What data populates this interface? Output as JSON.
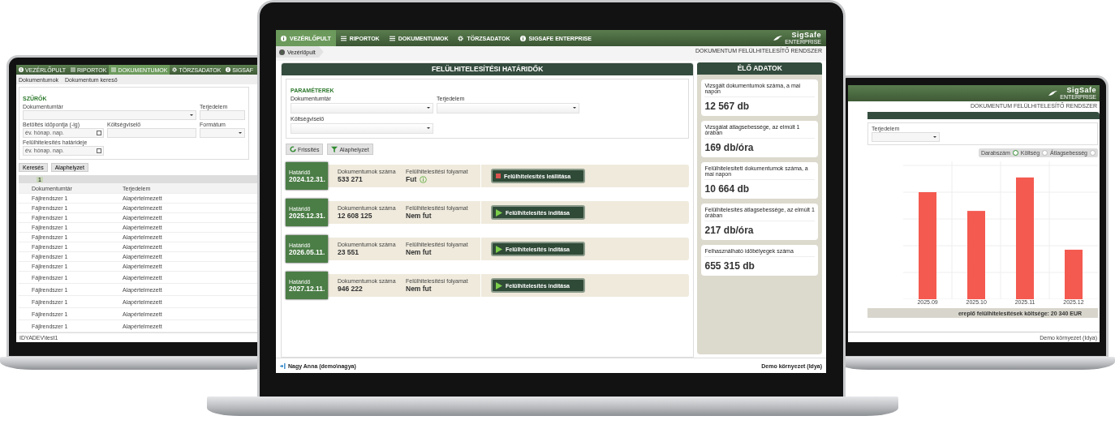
{
  "center": {
    "nav": [
      {
        "label": "VEZÉRLŐPULT",
        "selected": true
      },
      {
        "label": "RIPORTOK",
        "selected": false
      },
      {
        "label": "DOKUMENTUMOK",
        "selected": false
      },
      {
        "label": "TÖRZSADATOK",
        "selected": false
      },
      {
        "label": "SIGSAFE ENTERPRISE",
        "selected": false
      }
    ],
    "logo": {
      "name": "SigSafe",
      "sub": "ENTERPRISE"
    },
    "breadcrumb": "Vezérlőpult",
    "system_title": "DOKUMENTUM FELÜLHITELESÍTŐ RENDSZER",
    "deadlines": {
      "title": "FELÜLHITELESÍTÉSI HATÁRIDŐK",
      "legend": "PARAMÉTEREK",
      "fields": [
        {
          "label": "Dokumentumtár"
        },
        {
          "label": "Terjedelem"
        },
        {
          "label": "Költségviselő"
        }
      ],
      "buttons": [
        "Frissítés",
        "Alaphelyzet"
      ],
      "rows": [
        {
          "deadline_label": "Határidő",
          "date": "2024.12.31.",
          "count_label": "Dokumentumok száma",
          "count": "533 271",
          "process_label": "Felülhitelesítési folyamat",
          "status": "Fut",
          "running": true,
          "action": "Felülhitelesítés leállítása"
        },
        {
          "deadline_label": "Határidő",
          "date": "2025.12.31.",
          "count_label": "Dokumentumok száma",
          "count": "12 608 125",
          "process_label": "Felülhitelesítési folyamat",
          "status": "Nem fut",
          "running": false,
          "action": "Felülhitelesítés indítása"
        },
        {
          "deadline_label": "Határidő",
          "date": "2026.05.11.",
          "count_label": "Dokumentumok száma",
          "count": "23 551",
          "process_label": "Felülhitelesítési folyamat",
          "status": "Nem fut",
          "running": false,
          "action": "Felülhitelesítés indítása"
        },
        {
          "deadline_label": "Határidő",
          "date": "2027.12.11.",
          "count_label": "Dokumentumok száma",
          "count": "946 222",
          "process_label": "Felülhitelesítési folyamat",
          "status": "Nem fut",
          "running": false,
          "action": "Felülhitelesítés indítása"
        }
      ]
    },
    "live": {
      "title": "ÉLŐ ADATOK",
      "cards": [
        {
          "label": "Vizsgált dokumentumok száma, a mai napon",
          "value": "12 567 db"
        },
        {
          "label": "Vizsgálat átlagsebessége, az elmúlt 1 órában",
          "value": "169 db/óra"
        },
        {
          "label": "Felülhitelesített dokumentumok száma, a mai napon",
          "value": "10 664 db"
        },
        {
          "label": "Felülhitelesítés átlagsebessége, az elmúlt 1 órában",
          "value": "217 db/óra"
        },
        {
          "label": "Felhasználható időbélyegek száma",
          "value": "655 315 db"
        }
      ]
    },
    "footer": {
      "user": "Nagy Anna (demo\\nagya)",
      "environment": "Demo környezet (Idya)"
    }
  },
  "left_laptop": {
    "nav": [
      {
        "label": "VEZÉRLŐPULT",
        "selected": false
      },
      {
        "label": "RIPORTOK",
        "selected": false
      },
      {
        "label": "DOKUMENTUMOK",
        "selected": true
      },
      {
        "label": "TÖRZSADATOK",
        "selected": false
      },
      {
        "label": "SIGSAF",
        "selected": false
      }
    ],
    "breadcrumbs": [
      "Dokumentumok",
      "Dokumentum kereső"
    ],
    "legend": "SZŰRŐK",
    "fields": [
      {
        "label": "Dokumentumtár",
        "kind": "select"
      },
      {
        "label": "Terjedelem",
        "kind": "text"
      },
      {
        "label": "Betöltés időpontja (-ig)",
        "kind": "date",
        "placeholder": "év. hónap. nap."
      },
      {
        "label": "Költségviselő",
        "kind": "text"
      },
      {
        "label": "Formátum",
        "kind": "select"
      },
      {
        "label": "Felülhitelesítés határideje",
        "kind": "date",
        "placeholder": "év. hónap. nap."
      }
    ],
    "buttons": [
      "Keresés",
      "Alaphelyzet"
    ],
    "page": "1",
    "columns": [
      "Dokumentumtár",
      "Terjedelem"
    ],
    "rows": [
      [
        "Fájlrendszer 1",
        "Alapértelmezett"
      ],
      [
        "Fájlrendszer 1",
        "Alapértelmezett"
      ],
      [
        "Fájlrendszer 1",
        "Alapértelmezett"
      ],
      [
        "Fájlrendszer 1",
        "Alapértelmezett"
      ],
      [
        "Fájlrendszer 1",
        "Alapértelmezett"
      ],
      [
        "Fájlrendszer 1",
        "Alapértelmezett"
      ],
      [
        "Fájlrendszer 1",
        "Alapértelmezett"
      ],
      [
        "Fájlrendszer 1",
        "Alapértelmezett"
      ],
      [
        "Fájlrendszer 1",
        "Alapértelmezett"
      ],
      [
        "Fájlrendszer 1",
        "Alapértelmezett"
      ],
      [
        "Fájlrendszer 1",
        "Alapértelmezett"
      ],
      [
        "Fájlrendszer 1",
        "Alapértelmezett"
      ],
      [
        "Fájlrendszer 1",
        "Alapértelmezett"
      ]
    ],
    "footer": "IDYADEV\\test1"
  },
  "right_laptop": {
    "logo": {
      "name": "SigSafe",
      "sub": "ENTERPRISE"
    },
    "system_title": "DOKUMENTUM FELÜLHITELESÍTŐ RENDSZER",
    "field_label": "Terjedelem",
    "options": [
      {
        "label": "Darabszám",
        "selected": true
      },
      {
        "label": "Költség",
        "selected": false
      },
      {
        "label": "Átlagsebesség",
        "selected": false
      }
    ],
    "months": [
      "2025.09",
      "2025.10",
      "2025.11",
      "2025.12"
    ],
    "summary": "ereplő felülhitelesítések költsége: 20 340 EUR",
    "environment": "Demo környezet (Idya)"
  }
}
